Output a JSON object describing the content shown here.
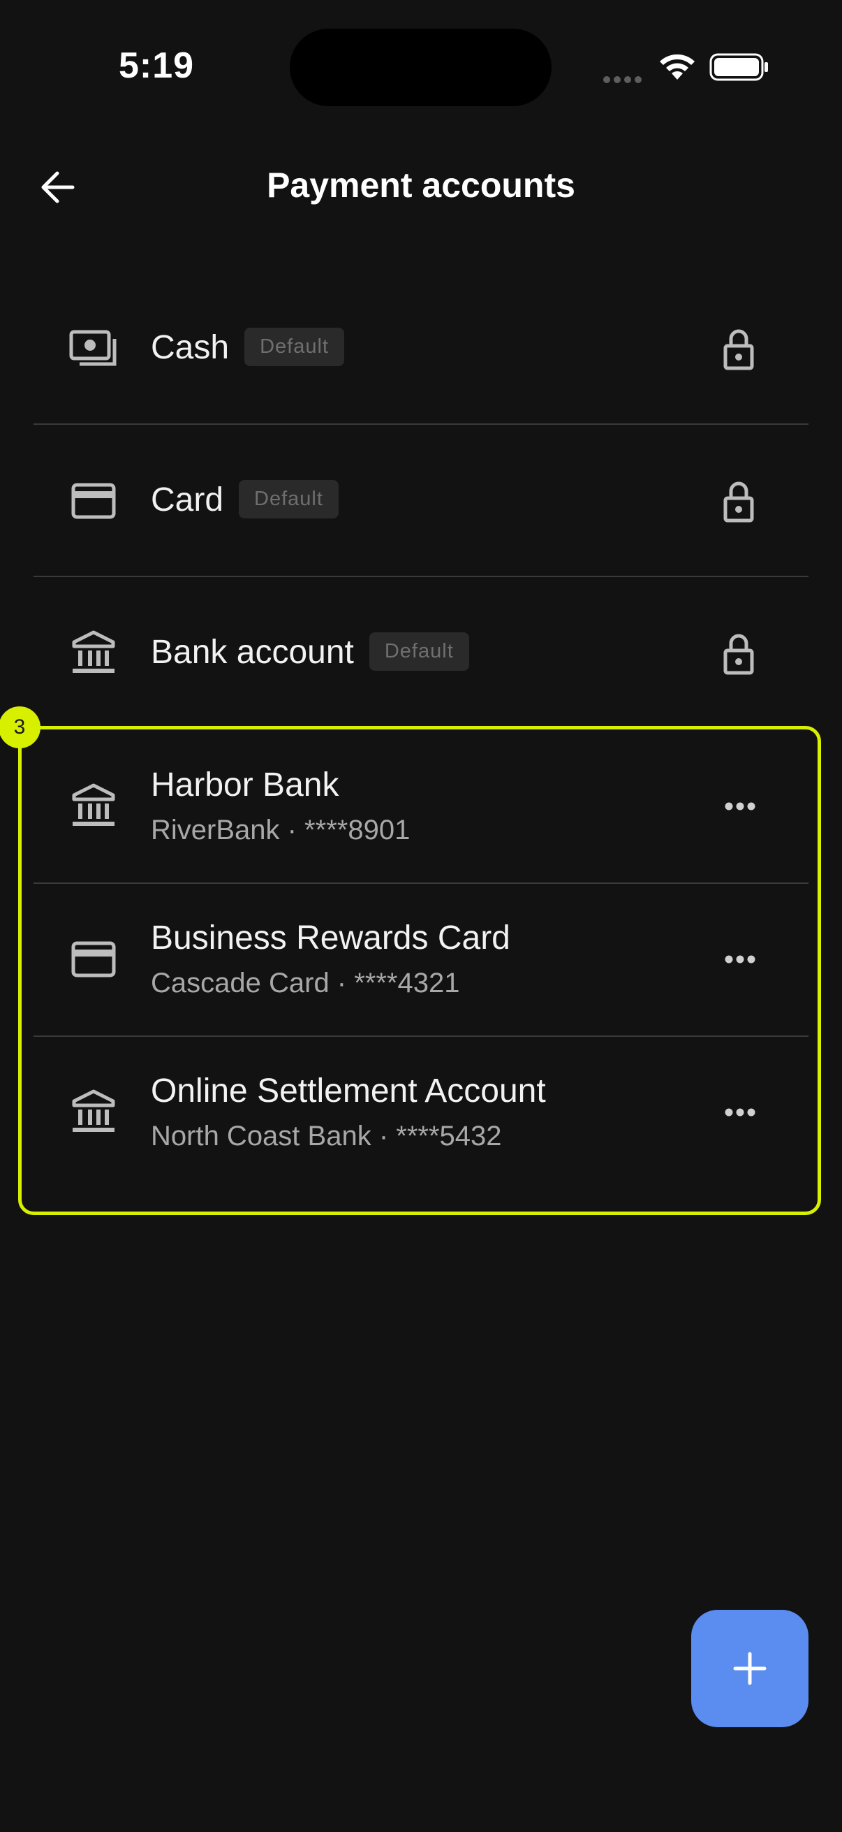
{
  "status_bar": {
    "time": "5:19"
  },
  "header": {
    "title": "Payment accounts",
    "back_icon": "arrow-left-icon"
  },
  "default_accounts": [
    {
      "title": "Cash",
      "badge": "Default",
      "icon": "cash-icon",
      "trailing_icon": "lock-icon"
    },
    {
      "title": "Card",
      "badge": "Default",
      "icon": "credit-card-icon",
      "trailing_icon": "lock-icon"
    },
    {
      "title": "Bank account",
      "badge": "Default",
      "icon": "bank-icon",
      "trailing_icon": "lock-icon"
    }
  ],
  "custom_accounts": [
    {
      "title": "Harbor Bank",
      "subtitle": "RiverBank · ****8901",
      "icon": "bank-icon",
      "trailing_icon": "more-horizontal-icon"
    },
    {
      "title": "Business Rewards Card",
      "subtitle": "Cascade Card · ****4321",
      "icon": "credit-card-icon",
      "trailing_icon": "more-horizontal-icon"
    },
    {
      "title": "Online Settlement Account",
      "subtitle": "North Coast Bank · ****5432",
      "icon": "bank-icon",
      "trailing_icon": "more-horizontal-icon"
    }
  ],
  "highlight": {
    "label": "3",
    "color": "#d6f000"
  },
  "fab": {
    "icon": "plus-icon",
    "color": "#5b8cf0"
  },
  "colors": {
    "background": "#121212",
    "divider": "#3a3a3a",
    "subtitle": "#a8a8a8"
  }
}
